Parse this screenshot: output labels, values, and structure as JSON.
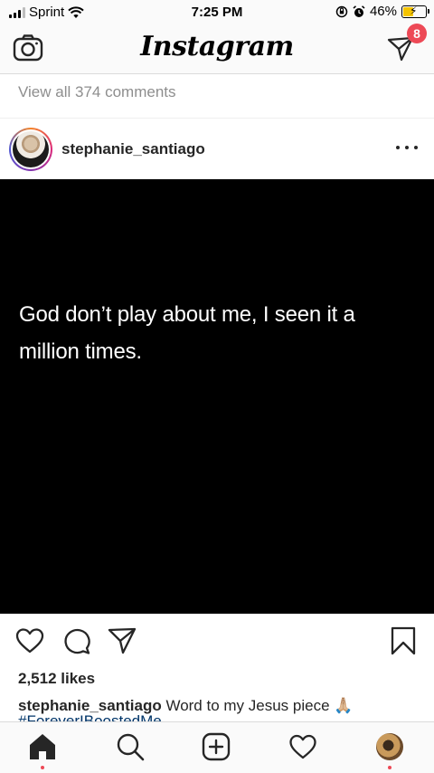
{
  "status_bar": {
    "carrier": "Sprint",
    "time": "7:25 PM",
    "battery_percent": "46%",
    "battery_level": 0.46,
    "battery_color": "#f5c400"
  },
  "nav": {
    "logo": "Instagram",
    "camera_icon": "camera-icon",
    "direct_icon": "direct-message-icon",
    "direct_badge": "8",
    "badge_color": "#ed4956"
  },
  "previous_post": {
    "view_comments": "View all 374 comments"
  },
  "post": {
    "username": "stephanie_santiago",
    "image_text": "God don’t play about me, I seen it a million times.",
    "likes": "2,512 likes",
    "caption_user": "stephanie_santiago",
    "caption_text": "Word to my Jesus piece 🙏🏼",
    "hashtags": "#ForeverIBoostedMe"
  },
  "actions": [
    "heart-icon",
    "comment-icon",
    "share-icon",
    "bookmark-icon"
  ],
  "tab_bar": {
    "items": [
      "home-icon",
      "search-icon",
      "new-post-icon",
      "activity-icon",
      "profile-avatar"
    ],
    "active": "home-icon"
  }
}
